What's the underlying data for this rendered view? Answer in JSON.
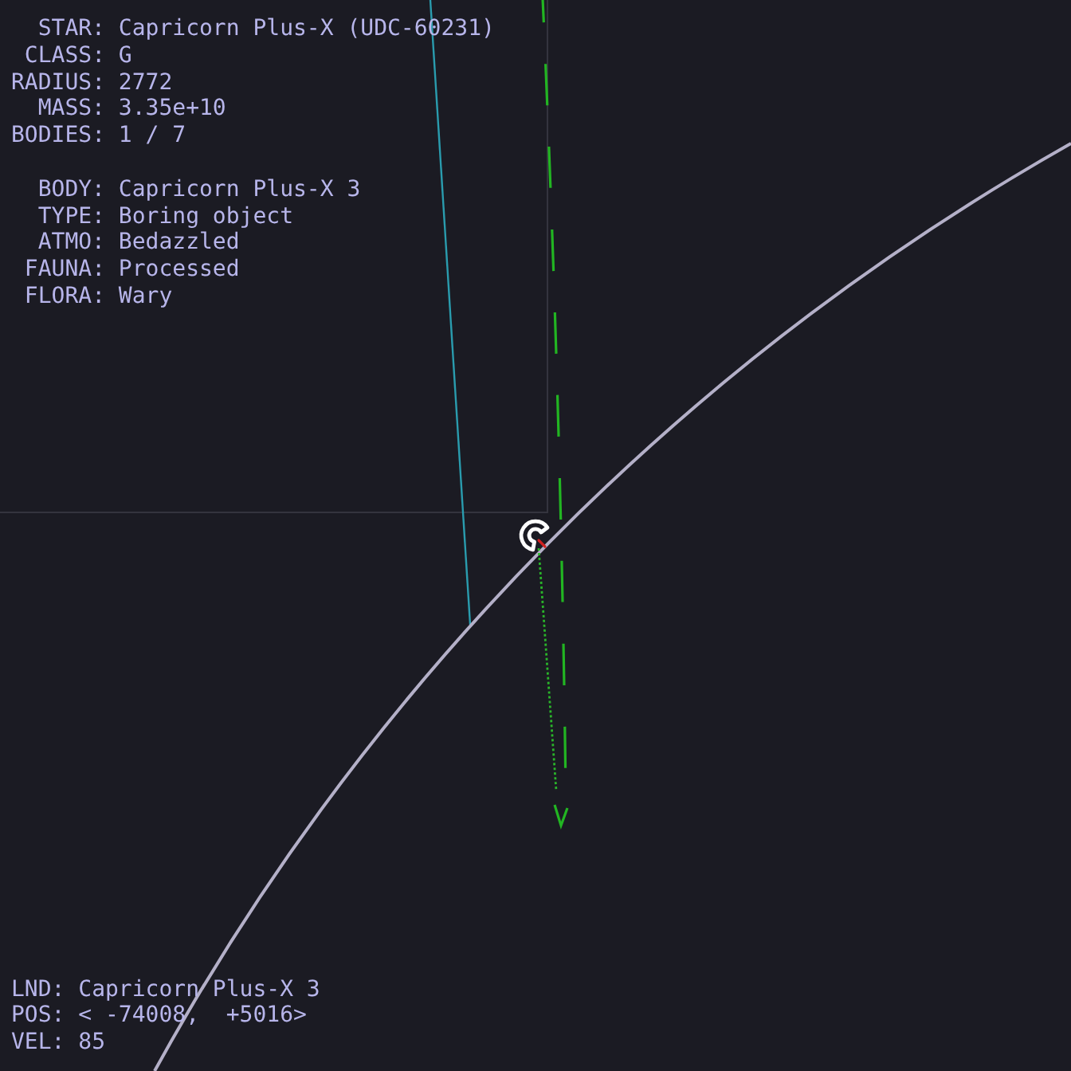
{
  "star_panel": [
    {
      "label": "STAR:",
      "value": "Capricorn Plus-X (UDC-60231)"
    },
    {
      "label": "CLASS:",
      "value": "G"
    },
    {
      "label": "RADIUS:",
      "value": "2772"
    },
    {
      "label": "MASS:",
      "value": "3.35e+10"
    },
    {
      "label": "BODIES:",
      "value": "1 / 7"
    }
  ],
  "body_panel": [
    {
      "label": "BODY:",
      "value": "Capricorn Plus-X 3"
    },
    {
      "label": "TYPE:",
      "value": "Boring object"
    },
    {
      "label": "ATMO:",
      "value": "Bedazzled"
    },
    {
      "label": "FAUNA:",
      "value": "Processed"
    },
    {
      "label": "FLORA:",
      "value": "Wary"
    }
  ],
  "lander_panel": [
    {
      "label": "LND:",
      "value": "Capricorn Plus-X 3"
    },
    {
      "label": "POS:",
      "value": "< -74008,  +5016>"
    },
    {
      "label": "VEL:",
      "value": "85"
    }
  ]
}
